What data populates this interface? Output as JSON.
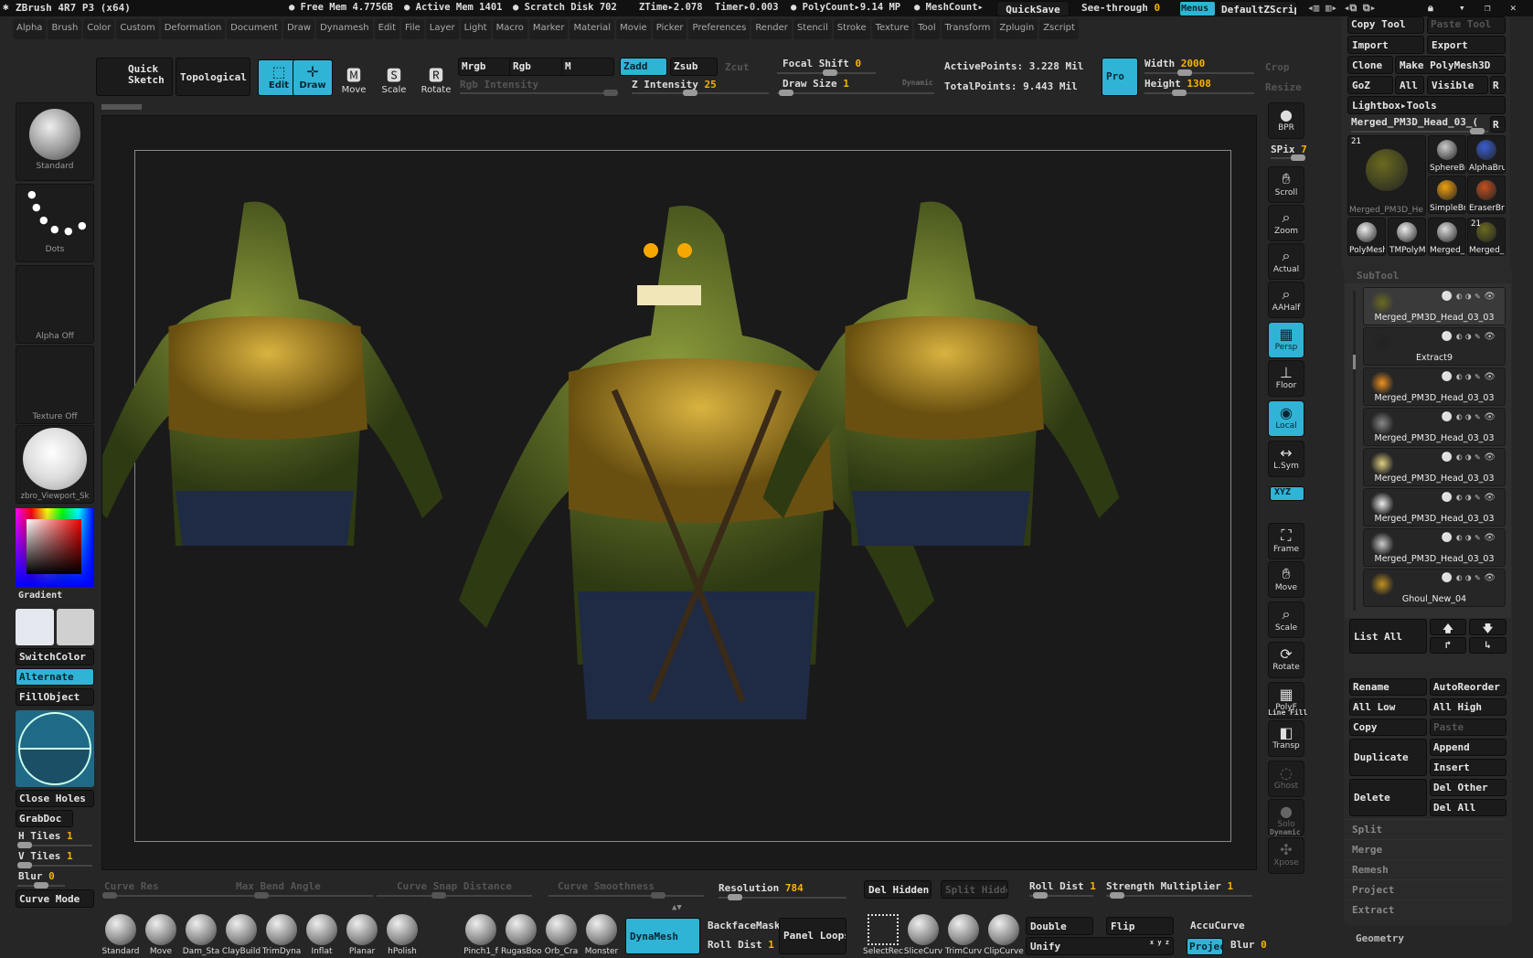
{
  "titlebar": {
    "app": "ZBrush 4R7 P3 (x64)",
    "free_mem": "● Free Mem 4.775GB",
    "active_mem": "● Active Mem 1401",
    "scratch": "● Scratch Disk 702",
    "ztime": "ZTime▸2.078",
    "timer": "Timer▸0.003",
    "polycount": "● PolyCount▸9.14 MP",
    "meshcount": "● MeshCount▸",
    "quicksave": "QuickSave",
    "see_through_label": "See-through",
    "see_through_value": "0",
    "menus": "Menus",
    "script": "DefaultZScript"
  },
  "menus": [
    "Alpha",
    "Brush",
    "Color",
    "Custom",
    "Deformation",
    "Document",
    "Draw",
    "Dynamesh",
    "Edit",
    "File",
    "Layer",
    "Light",
    "Macro",
    "Marker",
    "Material",
    "Movie",
    "Picker",
    "Preferences",
    "Render",
    "Stencil",
    "Stroke",
    "Texture",
    "Tool",
    "Transform",
    "Zplugin",
    "Zscript"
  ],
  "shelf": {
    "quick_sketch": "Quick Sketch",
    "topological": "Topological",
    "edit": "Edit",
    "draw": "Draw",
    "move": "Move",
    "scale": "Scale",
    "rotate": "Rotate",
    "mrgb": "Mrgb",
    "rgb": "Rgb",
    "m": "M",
    "zadd": "Zadd",
    "zsub": "Zsub",
    "zcut": "Zcut",
    "rgb_intensity": "Rgb Intensity",
    "z_intensity_label": "Z Intensity",
    "z_intensity": "25",
    "focal_shift_label": "Focal Shift",
    "focal_shift": "0",
    "draw_size_label": "Draw Size",
    "draw_size": "1",
    "dynamic": "Dynamic",
    "active_points": "ActivePoints: 3.228 Mil",
    "total_points": "TotalPoints: 9.443 Mil",
    "pro": "Pro",
    "width_label": "Width",
    "width": "2000",
    "height_label": "Height",
    "height": "1308",
    "crop": "Crop",
    "resize": "Resize"
  },
  "left": {
    "brush": "Standard",
    "stroke": "Dots",
    "alpha": "Alpha Off",
    "texture": "Texture Off",
    "material": "zbro_Viewport_Sk",
    "gradient": "Gradient",
    "switch_color": "SwitchColor",
    "alternate": "Alternate",
    "fill_object": "FillObject",
    "close_holes": "Close Holes",
    "grabdoc": "GrabDoc",
    "h_tiles_label": "H Tiles",
    "h_tiles": "1",
    "v_tiles_label": "V Tiles",
    "v_tiles": "1",
    "blur_label": "Blur",
    "blur": "0",
    "curve_mode": "Curve Mode"
  },
  "right_toolbar": [
    {
      "label": "BPR",
      "icon": "bpr-sphere-icon"
    },
    {
      "label": "Scroll",
      "icon": "hand-icon"
    },
    {
      "label": "Zoom",
      "icon": "magnifier-icon"
    },
    {
      "label": "Actual",
      "icon": "magnifier-x1-icon"
    },
    {
      "label": "AAHalf",
      "icon": "magnifier-half-icon"
    },
    {
      "label": "Persp",
      "icon": "grid-perspective-icon",
      "active": true
    },
    {
      "label": "Floor",
      "icon": "floor-icon"
    },
    {
      "label": "Local",
      "icon": "local-icon",
      "active": true
    },
    {
      "label": "L.Sym",
      "icon": "symmetry-icon"
    },
    {
      "label": "Frame",
      "icon": "frame-icon"
    },
    {
      "label": "Move",
      "icon": "hand-move-icon"
    },
    {
      "label": "Scale",
      "icon": "scale-icon"
    },
    {
      "label": "Rotate",
      "icon": "rotate-icon"
    },
    {
      "label": "PolyF",
      "icon": "polyframe-icon"
    },
    {
      "label": "Transp",
      "icon": "transparency-icon"
    },
    {
      "label": "Ghost",
      "icon": "ghost-icon"
    },
    {
      "label": "Solo",
      "icon": "solo-icon"
    },
    {
      "label": "Xpose",
      "icon": "xpose-icon"
    }
  ],
  "spix_label": "SPix",
  "spix": "7",
  "xyz": "XYZ",
  "dynamic_label": "Dynamic",
  "line_fill": "Line Fill",
  "tool_panel": {
    "copy_tool": "Copy Tool",
    "paste_tool": "Paste Tool",
    "import": "Import",
    "export": "Export",
    "clone": "Clone",
    "make_polymesh": "Make PolyMesh3D",
    "goz": "GoZ",
    "all": "All",
    "visible": "Visible",
    "r": "R",
    "lightbox": "Lightbox▸Tools",
    "current_tool": "Merged_PM3D_Head_03_(",
    "count": "21",
    "thumbs": [
      "Merged_PM3D_He",
      "SphereBr",
      "AlphaBrus",
      "SimpleBr",
      "EraserBr",
      "PolyMesh",
      "TMPolyM",
      "Merged_I",
      "Merged_"
    ]
  },
  "subtool": {
    "title": "SubTool",
    "items": [
      "Merged_PM3D_Head_03_03",
      "Extract9",
      "Merged_PM3D_Head_03_03",
      "Merged_PM3D_Head_03_03",
      "Merged_PM3D_Head_03_03",
      "Merged_PM3D_Head_03_03",
      "Merged_PM3D_Head_03_03",
      "Ghoul_New_04"
    ],
    "list_all": "List All",
    "rename": "Rename",
    "autoreorder": "AutoReorder",
    "all_low": "All Low",
    "all_high": "All High",
    "copy": "Copy",
    "paste": "Paste",
    "duplicate": "Duplicate",
    "append": "Append",
    "insert": "Insert",
    "delete": "Delete",
    "del_other": "Del Other",
    "del_all": "Del All",
    "sections": [
      "Split",
      "Merge",
      "Remesh",
      "Project",
      "Extract"
    ],
    "geometry": "Geometry"
  },
  "bottom": {
    "curve_res": "Curve Res",
    "max_bend": "Max Bend Angle",
    "snap": "Curve Snap Distance",
    "smooth": "Curve Smoothness",
    "resolution_label": "Resolution",
    "resolution": "784",
    "del_hidden": "Del Hidden",
    "split_hidden": "Split Hidden",
    "roll_dist_label": "Roll Dist",
    "roll_dist": "1",
    "strength_label": "Strength Multiplier",
    "strength": "1",
    "brushes": [
      "Standard",
      "Move",
      "Dam_Sta",
      "ClayBuild",
      "TrimDyna",
      "Inflat",
      "Planar",
      "hPolish",
      "Pinch1_f",
      "RugasBoo",
      "Orb_Cra",
      "Monster"
    ],
    "dynamesh": "DynaMesh",
    "backface": "BackfaceMask",
    "roll_dist2_label": "Roll Dist",
    "roll_dist2": "1",
    "panel_loops": "Panel Loops",
    "tools": [
      "SelectRec",
      "SliceCurv",
      "TrimCurv",
      "ClipCurve"
    ],
    "double": "Double",
    "flip": "Flip",
    "accucurve": "AccuCurve",
    "unify": "Unify",
    "xyz_small": "x y z",
    "project": "Projec",
    "blur_label": "Blur",
    "blur": "0"
  },
  "colors": {
    "accent": "#2fb4d6",
    "value": "#f5b400",
    "bg": "#262626",
    "canvas": "#1a1a1a"
  }
}
